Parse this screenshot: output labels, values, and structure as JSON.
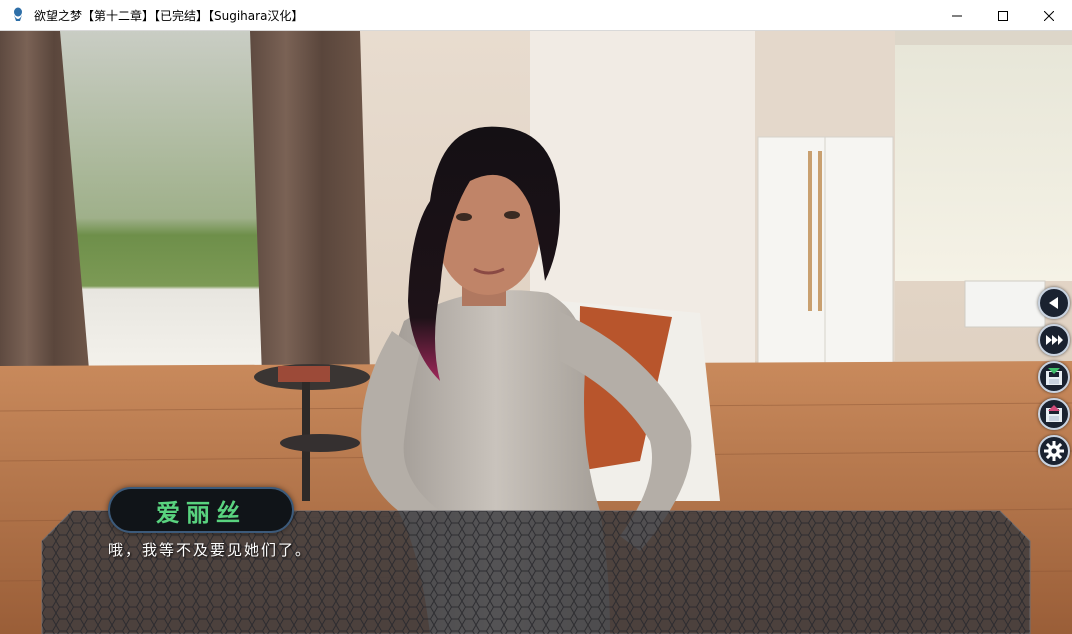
{
  "window": {
    "title": "欲望之梦【第十二章】【已完结】【Sugihara汉化】",
    "controls": [
      "minimize",
      "maximize",
      "close"
    ]
  },
  "dialogue": {
    "speaker": "爱丽丝",
    "text": "哦，我等不及要见她们了。"
  },
  "quick_menu": [
    {
      "name": "back-icon"
    },
    {
      "name": "skip-icon"
    },
    {
      "name": "save-icon"
    },
    {
      "name": "load-icon"
    },
    {
      "name": "settings-icon"
    }
  ],
  "colors": {
    "speaker_name": "#59d37f",
    "textbox_bg": "#3a3a3e",
    "floor": "#b5744a",
    "curtain": "#6b5548"
  }
}
